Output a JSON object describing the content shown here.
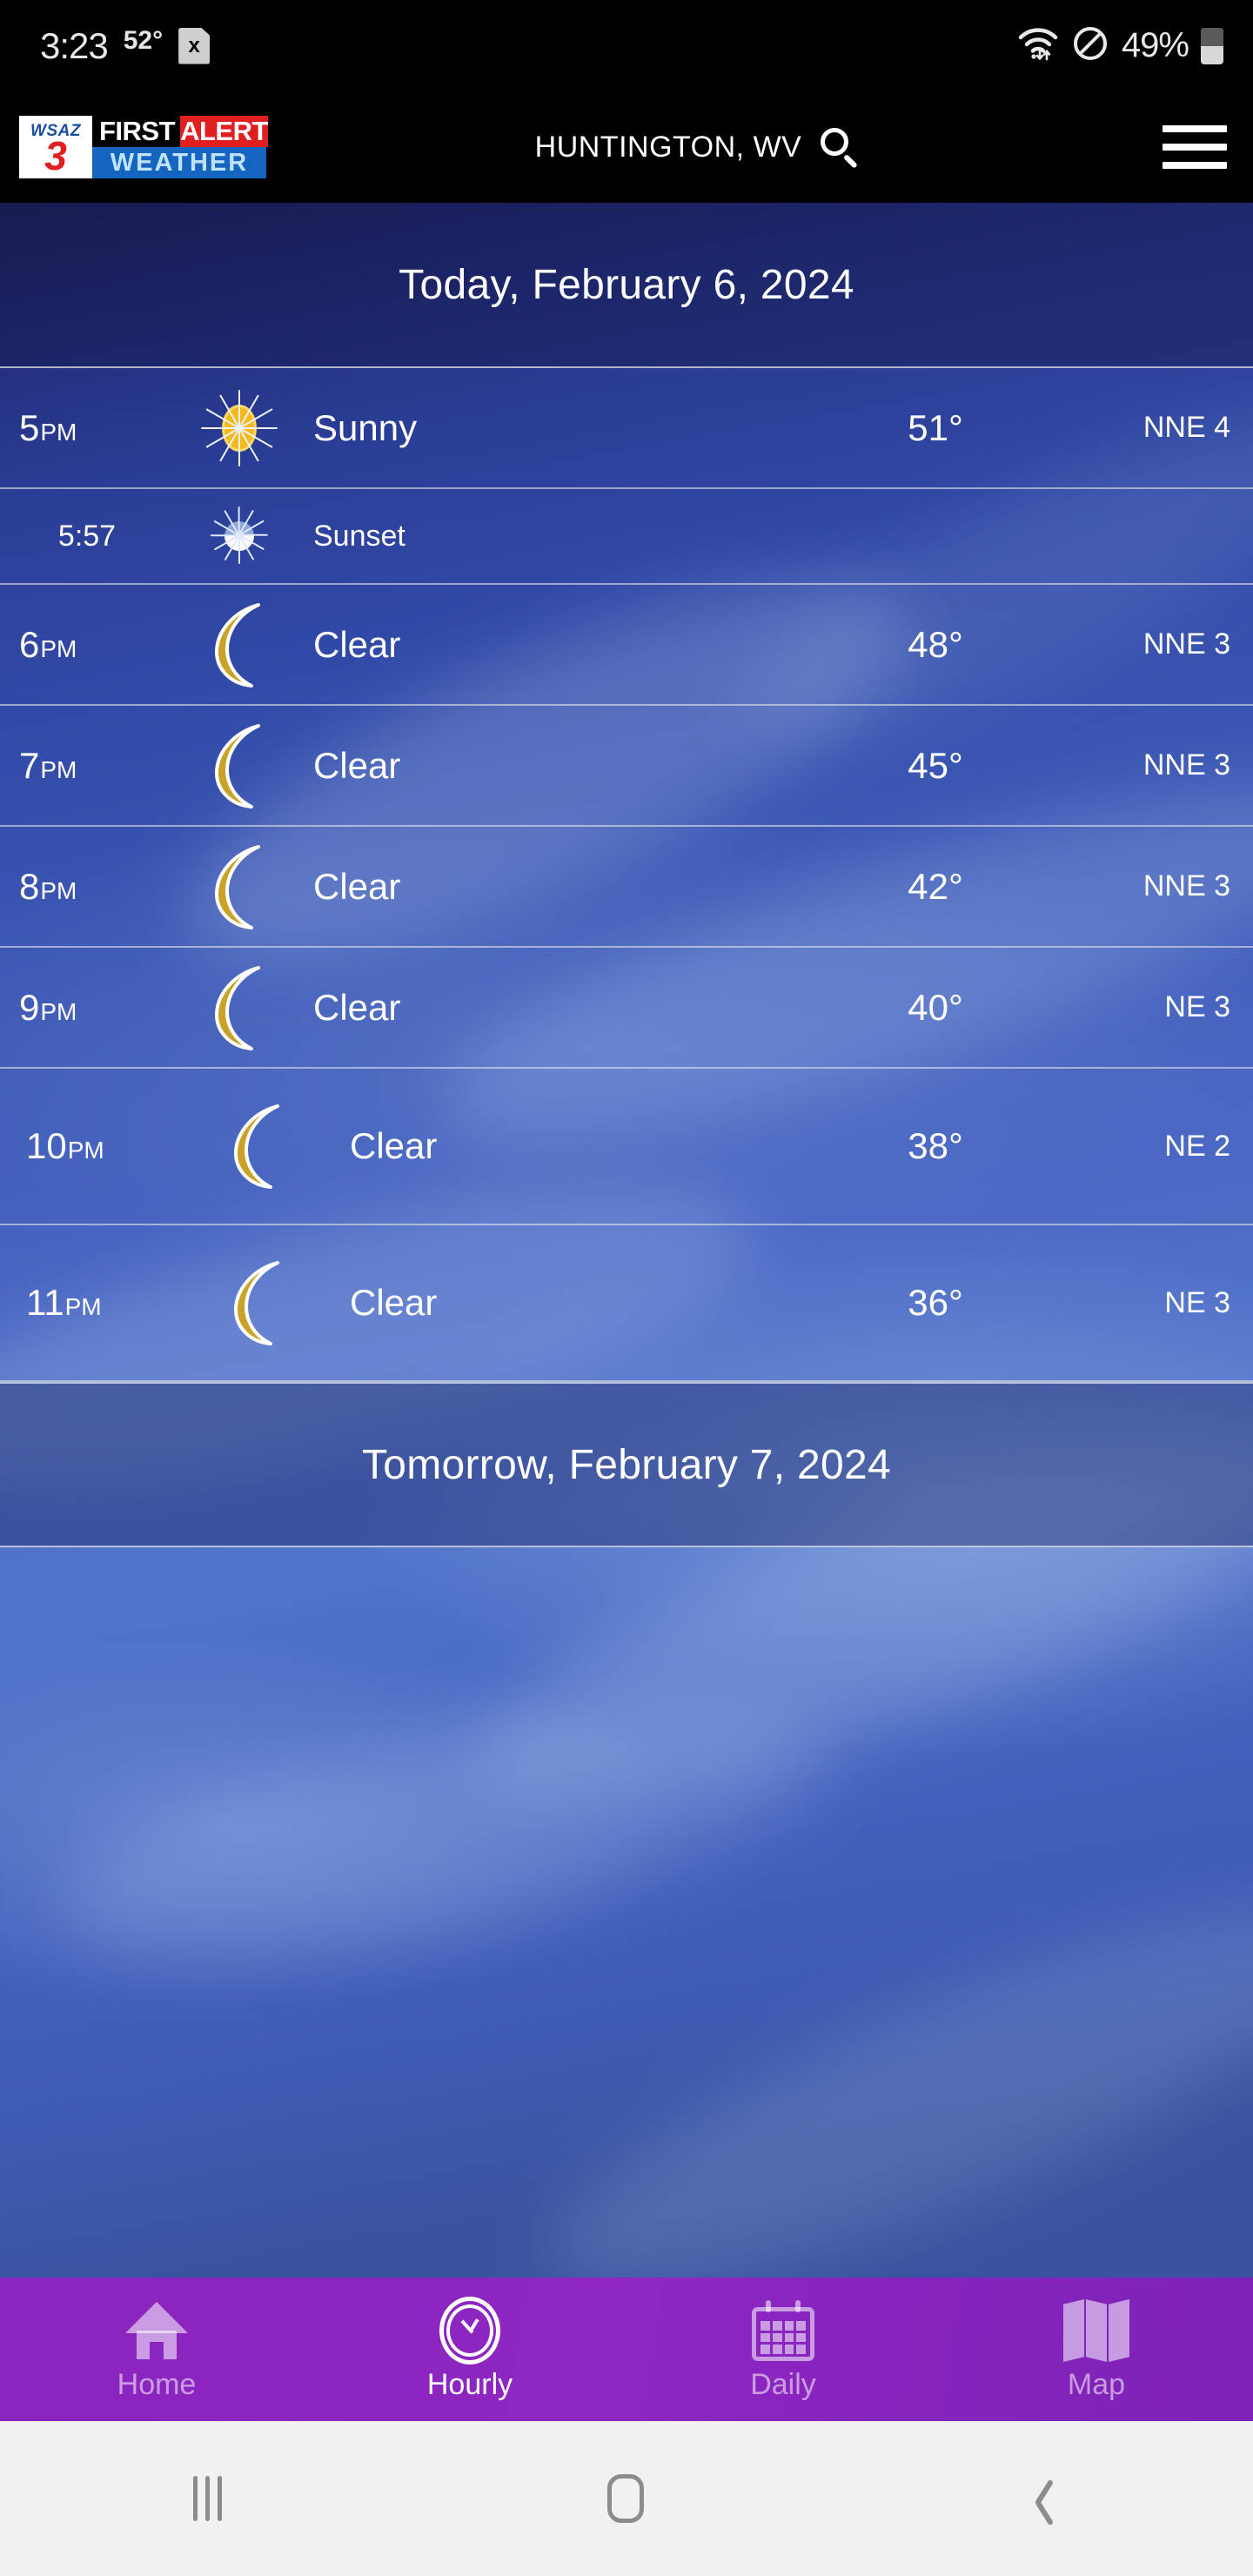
{
  "status_bar": {
    "time": "3:23",
    "temperature": "52°",
    "sd_card_label": "x",
    "battery_percent": "49%",
    "icons": [
      "sd-card-error-icon",
      "wifi-icon",
      "do-not-disturb-icon",
      "battery-icon"
    ]
  },
  "app_header": {
    "logo": {
      "station": "WSAZ",
      "channel": "3",
      "first": "FIRST",
      "alert": "ALERT",
      "weather": "WEATHER"
    },
    "location": "HUNTINGTON, WV",
    "search_icon": "search-icon",
    "menu_icon": "hamburger-menu-icon"
  },
  "colors": {
    "accent_purple": "#8b25bf",
    "alert_red": "#e02020",
    "logo_blue": "#1565c0",
    "sun_yellow": "#f5b91c",
    "moon_gold": "#c9a227"
  },
  "sections": [
    {
      "heading": "Today, February 6, 2024",
      "hours": [
        {
          "time": "5",
          "ampm": "PM",
          "icon": "sun-icon",
          "condition": "Sunny",
          "temp": "51°",
          "wind": "NNE 4",
          "sub_event": {
            "time": "5:57",
            "icon": "sunset-icon",
            "label": "Sunset"
          }
        },
        {
          "time": "6",
          "ampm": "PM",
          "icon": "moon-icon",
          "condition": "Clear",
          "temp": "48°",
          "wind": "NNE 3"
        },
        {
          "time": "7",
          "ampm": "PM",
          "icon": "moon-icon",
          "condition": "Clear",
          "temp": "45°",
          "wind": "NNE 3"
        },
        {
          "time": "8",
          "ampm": "PM",
          "icon": "moon-icon",
          "condition": "Clear",
          "temp": "42°",
          "wind": "NNE 3"
        },
        {
          "time": "9",
          "ampm": "PM",
          "icon": "moon-icon",
          "condition": "Clear",
          "temp": "40°",
          "wind": "NE 3"
        },
        {
          "time": "10",
          "ampm": "PM",
          "icon": "moon-icon",
          "condition": "Clear",
          "temp": "38°",
          "wind": "NE 2"
        },
        {
          "time": "11",
          "ampm": "PM",
          "icon": "moon-icon",
          "condition": "Clear",
          "temp": "36°",
          "wind": "NE 3"
        }
      ]
    },
    {
      "heading": "Tomorrow, February 7, 2024",
      "hours": []
    }
  ],
  "bottom_tabs": [
    {
      "label": "Home",
      "icon": "home-icon",
      "active": false
    },
    {
      "label": "Hourly",
      "icon": "clock-icon",
      "active": true
    },
    {
      "label": "Daily",
      "icon": "calendar-icon",
      "active": false
    },
    {
      "label": "Map",
      "icon": "map-icon",
      "active": false
    }
  ],
  "android_nav": {
    "recents": "recents-icon",
    "home": "home-button-icon",
    "back": "back-icon"
  }
}
